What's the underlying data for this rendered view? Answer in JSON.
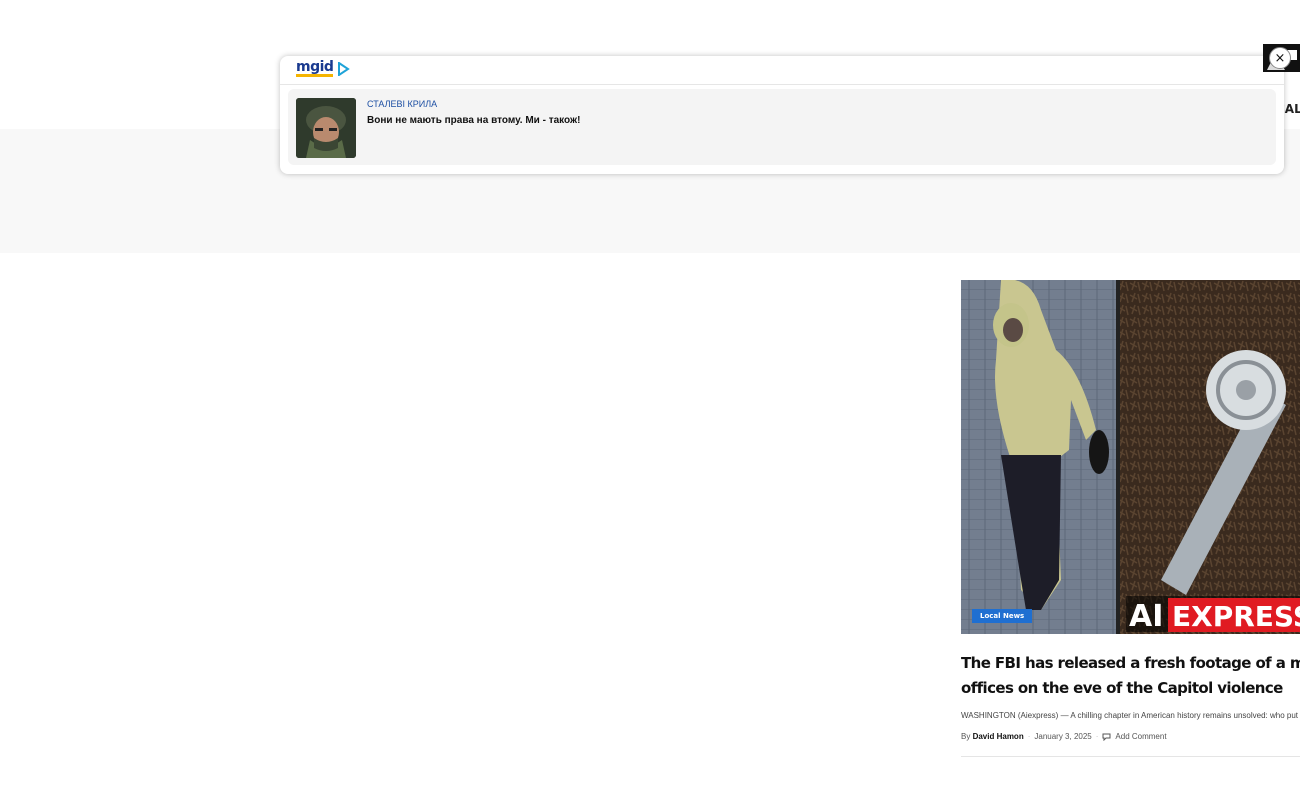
{
  "header": {
    "nav_fragment": "CAL N"
  },
  "ad": {
    "brand": "mgid",
    "source": "СТАЛЕВІ КРИЛА",
    "title": "Вони не мають права на втому. Ми - також!",
    "close_symbol": "×",
    "icons": {
      "logo": "mgid-logo",
      "play": "play-triangle-icon",
      "close": "close-icon"
    },
    "colors": {
      "source": "#1d4fa3",
      "card_bg": "#f4f4f4"
    }
  },
  "article": {
    "category": "Local News",
    "headline_line1": "The FBI has released a fresh footage of a man putting",
    "headline_line2": "offices on the eve of the Capitol violence",
    "excerpt": "WASHINGTON (Aiexpress) — A chilling chapter in American history remains unsolved: who put",
    "author_prefix": "By",
    "author": "David Hamon",
    "date": "January 3, 2025",
    "comments": "Add Comment",
    "image_watermark": "AI EXPRESS",
    "colors": {
      "badge": "#1f6fd1",
      "watermark_red": "#e01b22"
    }
  }
}
